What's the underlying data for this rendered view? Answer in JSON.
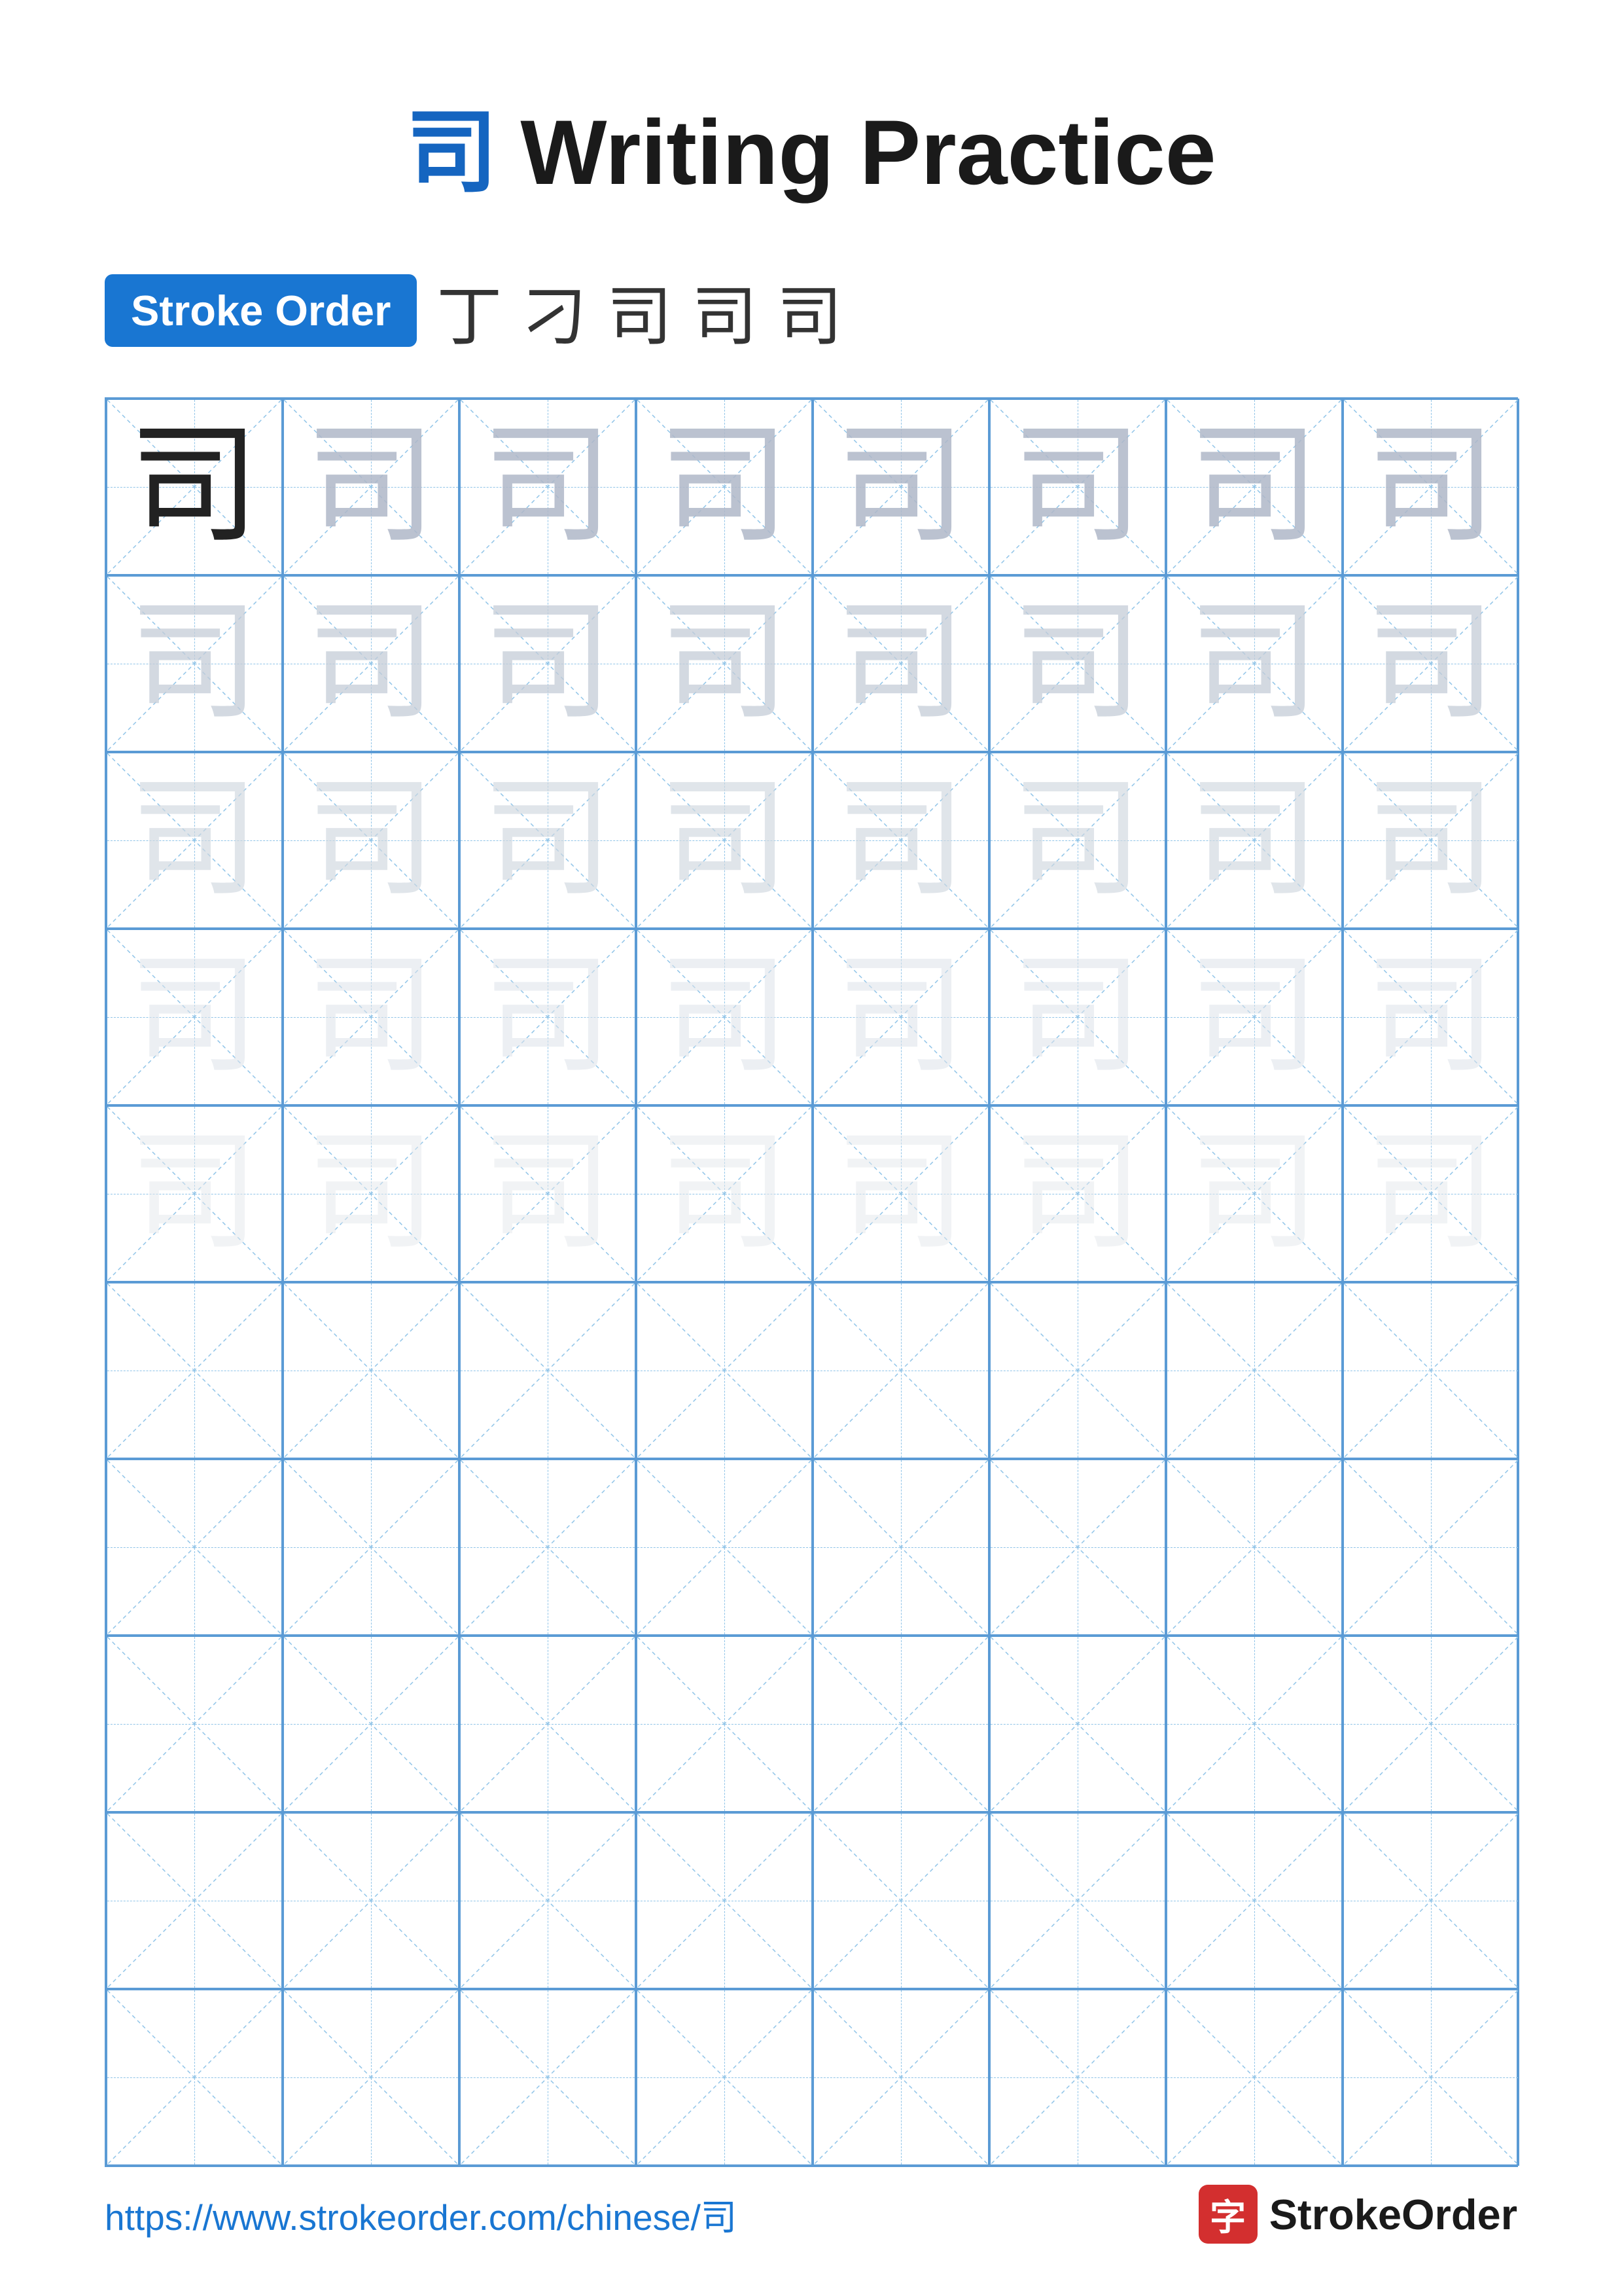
{
  "title": {
    "char": "司",
    "text": "Writing Practice"
  },
  "stroke_order": {
    "badge_label": "Stroke Order",
    "chars": [
      "丁",
      "刁",
      "司",
      "司",
      "司"
    ]
  },
  "grid": {
    "cols": 8,
    "rows": 10,
    "char": "司",
    "filled_rows": 5,
    "opacity_levels": [
      "dark",
      "light1",
      "light2",
      "light3",
      "light4"
    ]
  },
  "footer": {
    "url": "https://www.strokeorder.com/chinese/司",
    "logo_char": "字",
    "logo_text": "StrokeOrder"
  }
}
